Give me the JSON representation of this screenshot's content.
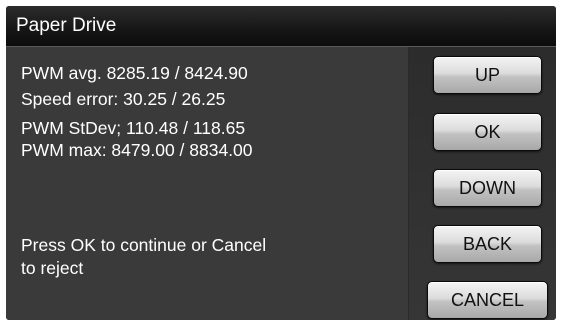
{
  "window": {
    "title": "Paper Drive"
  },
  "readings": {
    "pwm_avg": "PWM avg. 8285.19 / 8424.90",
    "speed_error": "Speed error: 30.25 / 26.25",
    "pwm_stdev": "PWM StDev; 110.48 / 118.65",
    "pwm_max": "PWM max: 8479.00 / 8834.00"
  },
  "message": {
    "line1": "Press OK to continue or Cancel",
    "line2": "to reject"
  },
  "buttons": {
    "up": "UP",
    "ok": "OK",
    "down": "DOWN",
    "back": "BACK",
    "cancel": "CANCEL"
  }
}
